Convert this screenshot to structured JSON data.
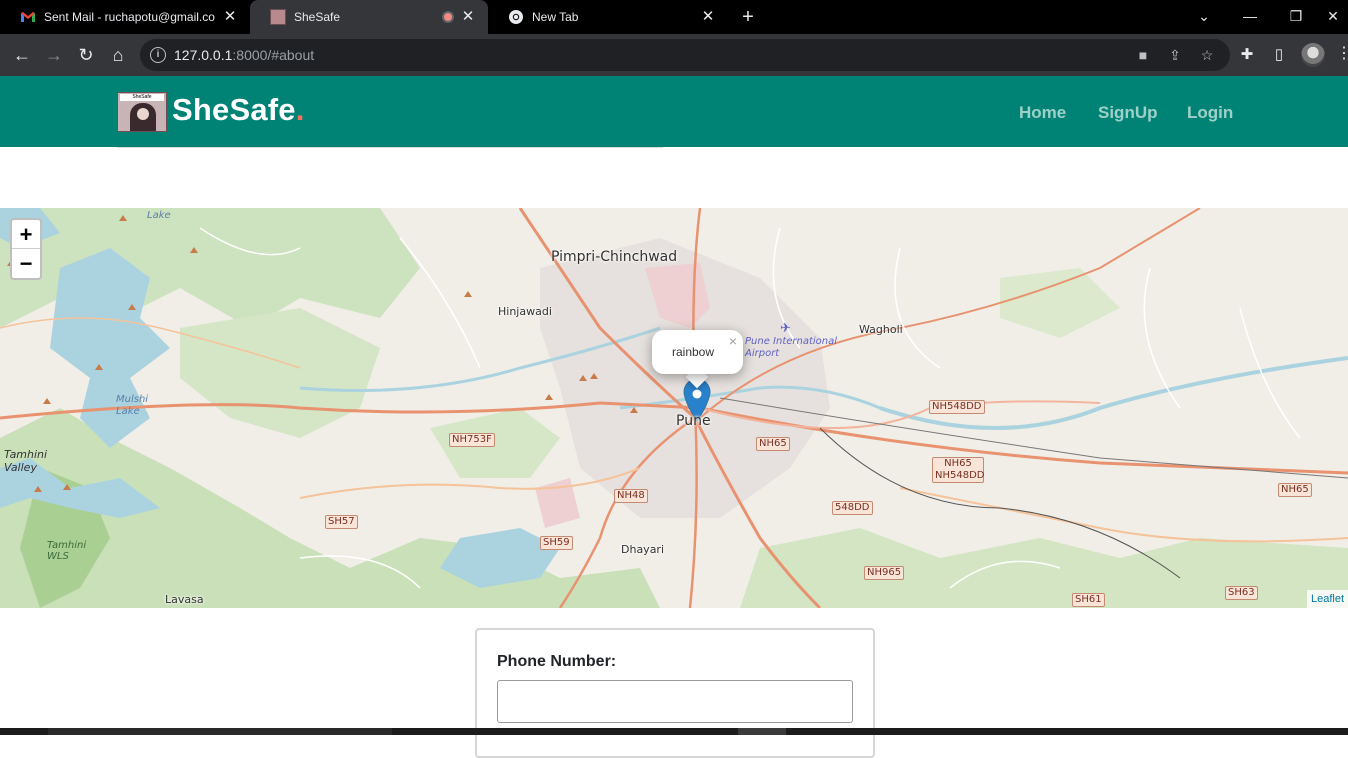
{
  "browser": {
    "tabs": [
      {
        "title": "Sent Mail - ruchapotu@gmail.co",
        "favicon": "gmail-icon",
        "active": false
      },
      {
        "title": "SheSafe",
        "favicon": "shesafe-favicon",
        "active": true,
        "recording": true
      },
      {
        "title": "New Tab",
        "favicon": "chrome-icon",
        "active": false
      }
    ],
    "url_host": "127.0.0.1",
    "url_rest": ":8000/#about"
  },
  "site": {
    "brand_name": "SheSafe",
    "brand_dot": ".",
    "logo_text": "SheSafe",
    "nav": [
      {
        "label": "Home"
      },
      {
        "label": "SignUp"
      },
      {
        "label": "Login"
      }
    ],
    "colors": {
      "header": "#008374",
      "accent": "#f96f59"
    }
  },
  "map": {
    "zoom_in": "+",
    "zoom_out": "−",
    "popup_text": "rainbow",
    "popup_close": "×",
    "attribution": "Leaflet",
    "labels": {
      "pune": "Pune",
      "pimpri": "Pimpri-Chinchwad",
      "hinjawadi": "Hinjawadi",
      "wagholi": "Wagholi",
      "airport": "Pune International Airport",
      "dhayari": "Dhayari",
      "lavasa": "Lavasa",
      "mulshi": "Mulshi Lake",
      "tamhini_valley": "Tamhini Valley",
      "tamhini_wls": "Tamhini WLS",
      "lake": "Lake"
    },
    "shields": {
      "nh753f": "NH753F",
      "nh48": "NH48",
      "nh65a": "NH65",
      "nh548dd": "NH548DD",
      "nh65b": "NH65",
      "nh548dd_b": "NH548DD",
      "nh65c": "NH65",
      "dd548": "548DD",
      "nh965": "NH965",
      "sh57": "SH57",
      "sh59": "SH59",
      "sh61": "SH61",
      "sh63": "SH63"
    }
  },
  "form": {
    "phone_label": "Phone Number:",
    "phone_value": ""
  }
}
